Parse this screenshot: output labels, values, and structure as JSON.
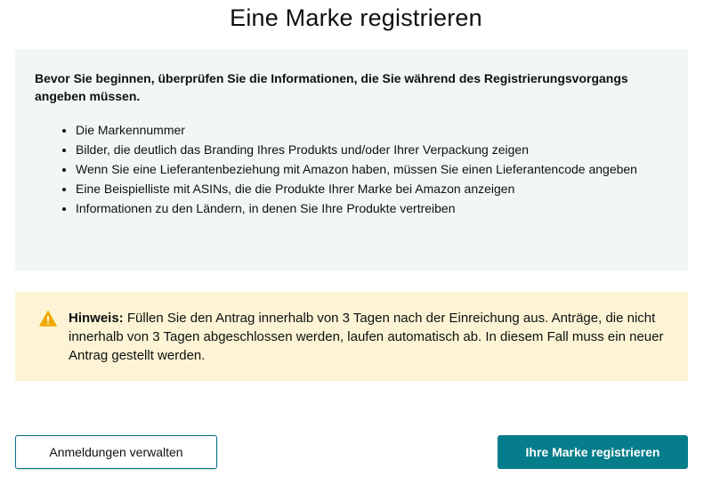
{
  "page": {
    "title": "Eine Marke registrieren"
  },
  "info": {
    "intro": "Bevor Sie beginnen, überprüfen Sie die Informationen, die Sie während des Registrierungsvorgangs angeben müssen.",
    "items": [
      "Die Markennummer",
      "Bilder, die deutlich das Branding Ihres Produkts und/oder Ihrer Verpackung zeigen",
      "Wenn Sie eine Lieferantenbeziehung mit Amazon haben, müssen Sie einen Lieferantencode angeben",
      "Eine Beispielliste mit ASINs, die die Produkte Ihrer Marke bei Amazon anzeigen",
      "Informationen zu den Ländern, in denen Sie Ihre Produkte vertreiben"
    ]
  },
  "notice": {
    "icon": "warning-icon",
    "label": "Hinweis:",
    "text": " Füllen Sie den Antrag innerhalb von 3 Tagen nach der Einreichung aus. Anträge, die nicht innerhalb von 3 Tagen abgeschlossen werden, laufen automatisch ab. In diesem Fall muss ein neuer Antrag gestellt werden."
  },
  "actions": {
    "manage_label": "Anmeldungen verwalten",
    "register_label": "Ihre Marke registrieren"
  },
  "colors": {
    "primary": "#067d8a",
    "info_bg": "#f3f6f6",
    "notice_bg": "#fcf4d4",
    "warning": "#f0a800"
  }
}
